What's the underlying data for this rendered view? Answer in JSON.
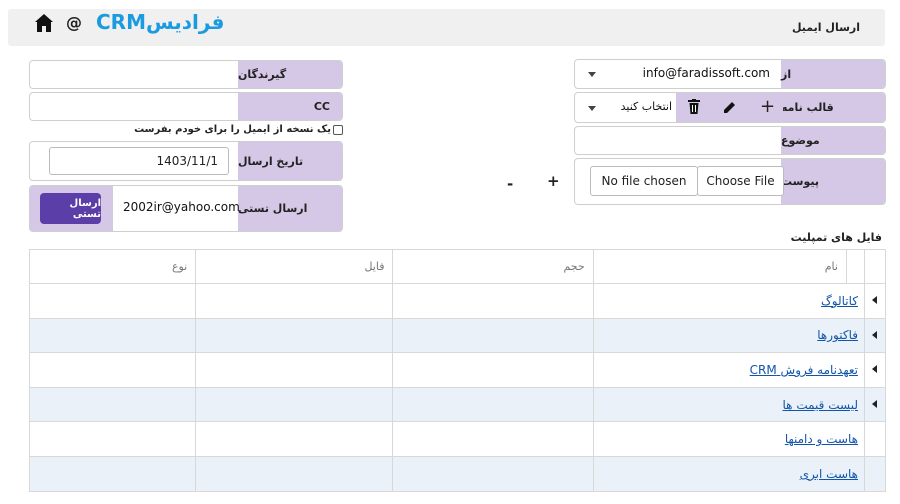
{
  "header": {
    "page_title": "ارسال ایمیل",
    "brand": "فرادیسCRM",
    "at_symbol": "@"
  },
  "form_right": {
    "from": {
      "label": "از",
      "value": "info@faradissoft.com"
    },
    "template": {
      "label": "قالب نامه",
      "value": "انتخاب کنید",
      "add": "+"
    },
    "subject": {
      "label": "موضوع",
      "value": ""
    },
    "attachment": {
      "label": "پیوست",
      "choose": "Choose File",
      "status": "No file chosen"
    },
    "plus": "+",
    "minus": "-"
  },
  "form_left": {
    "recipients": {
      "label": "گیرندگان",
      "value": ""
    },
    "cc": {
      "label": "CC",
      "value": ""
    },
    "self_copy": "یک نسخه از ایمیل را برای خودم بفرست",
    "send_date": {
      "label": "تاریخ ارسال",
      "value": "1403/11/1"
    },
    "test_send": {
      "label": "ارسال تستی",
      "value": "2002ir@yahoo.com",
      "button": "ارسال تستی"
    }
  },
  "templates": {
    "title": "فایل های تمپلیت",
    "columns": [
      "نام",
      "حجم",
      "فایل",
      "نوع"
    ],
    "rows": [
      {
        "name": "کاتالوگ",
        "expandable": true
      },
      {
        "name": "فاکتورها",
        "expandable": true
      },
      {
        "name": "تعهدنامه فروش CRM",
        "expandable": true
      },
      {
        "name": "لیست قیمت ها",
        "expandable": true
      },
      {
        "name": "هاست و دامنها",
        "expandable": false
      },
      {
        "name": "هاست ابری",
        "expandable": false
      }
    ]
  }
}
